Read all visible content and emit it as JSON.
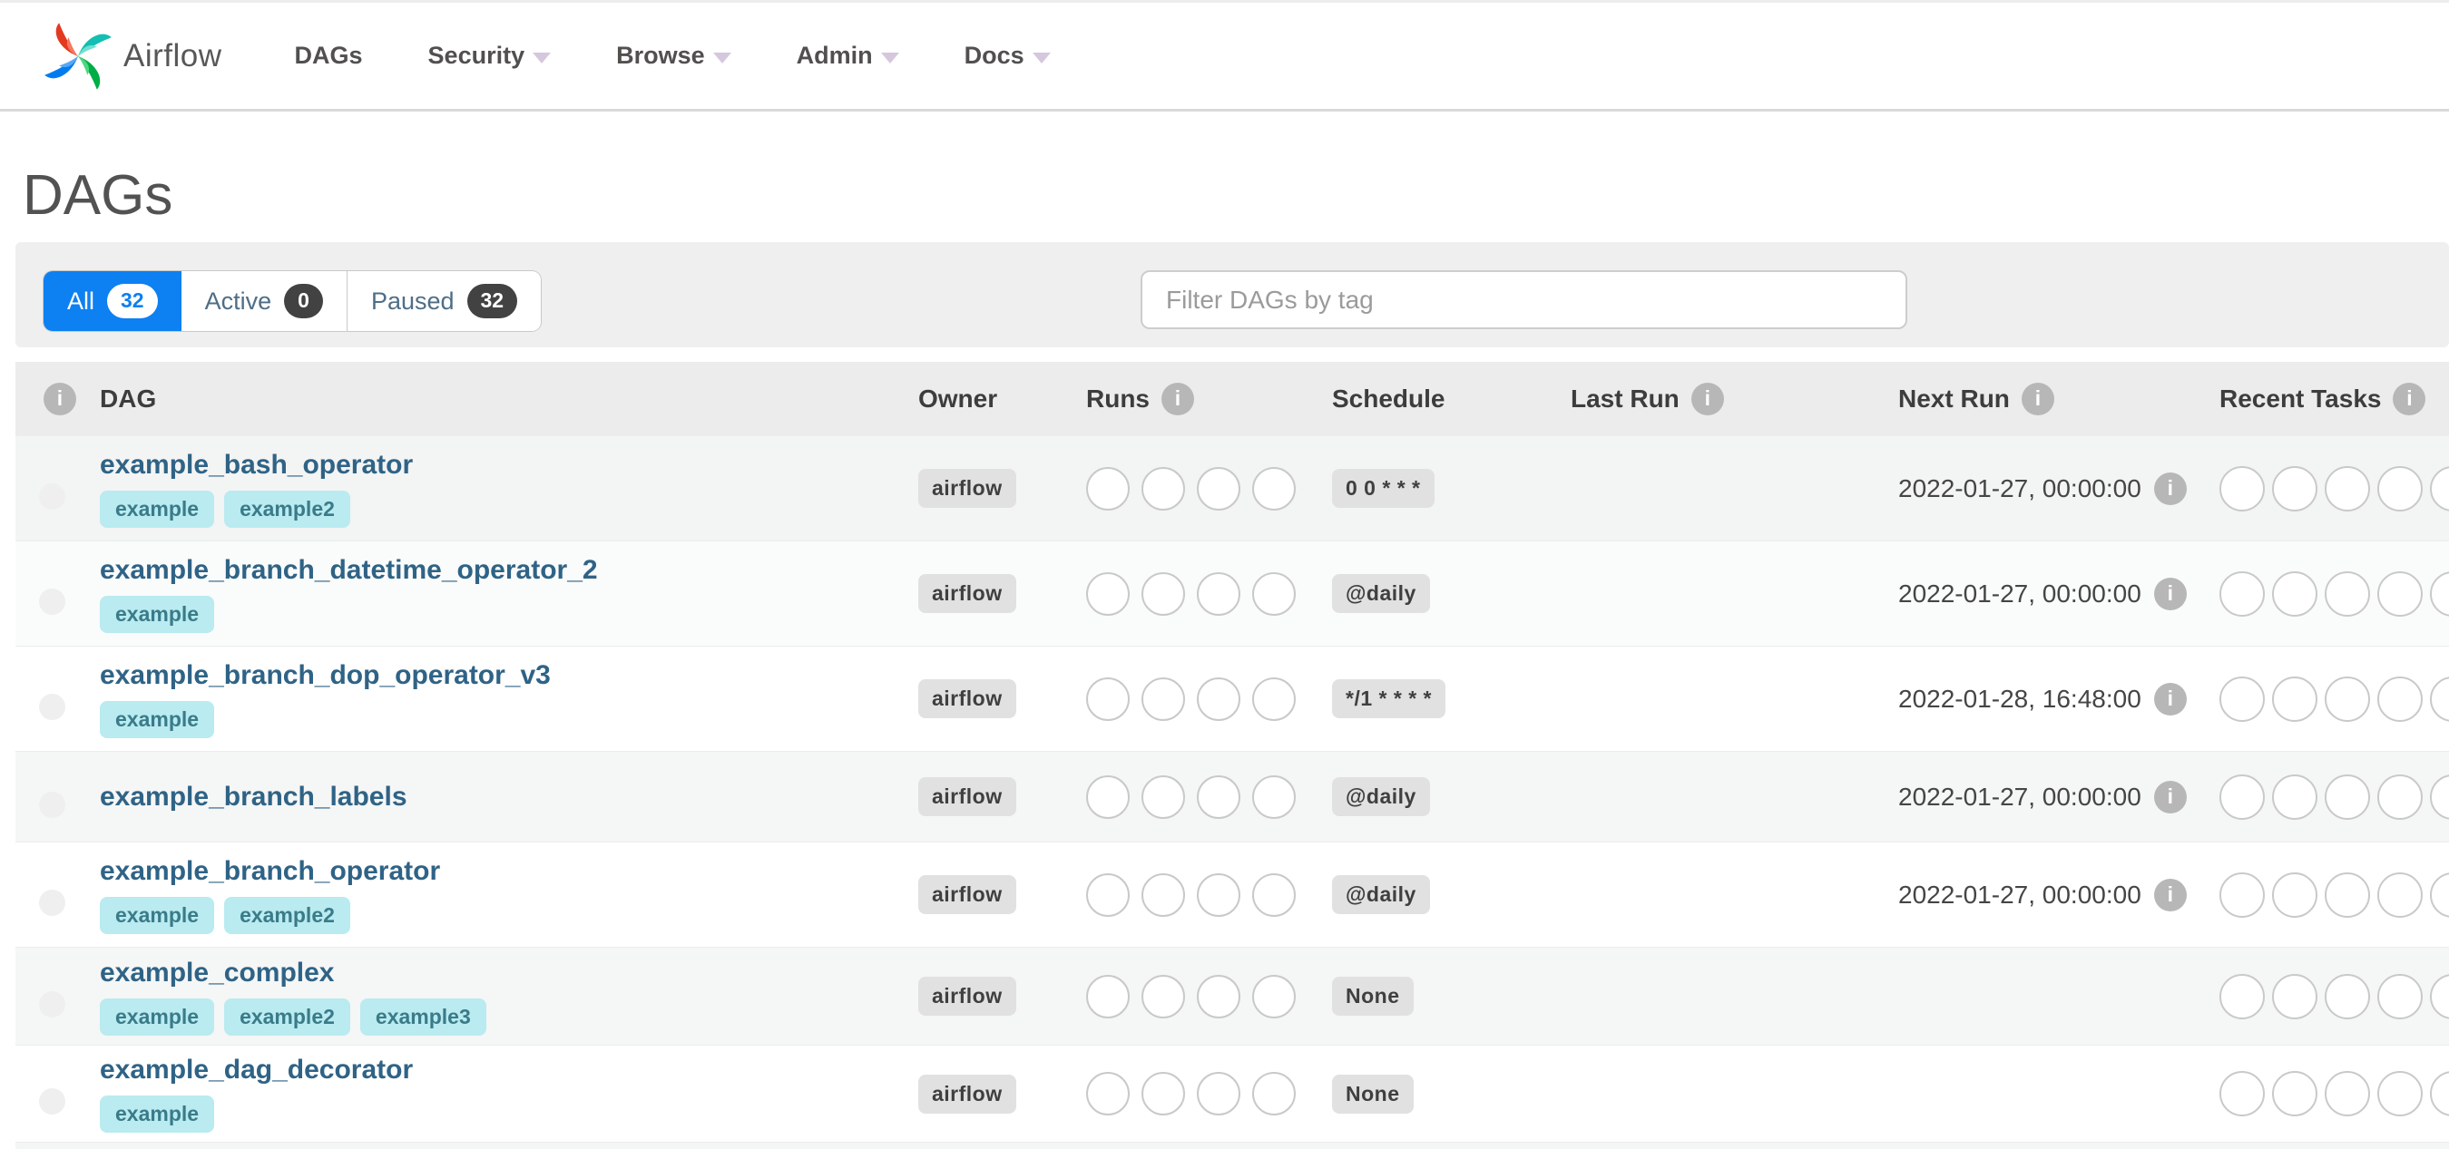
{
  "nav": {
    "brand": "Airflow",
    "items": [
      {
        "label": "DAGs",
        "caret": false
      },
      {
        "label": "Security",
        "caret": true
      },
      {
        "label": "Browse",
        "caret": true
      },
      {
        "label": "Admin",
        "caret": true
      },
      {
        "label": "Docs",
        "caret": true
      }
    ]
  },
  "page": {
    "title": "DAGs"
  },
  "filters": {
    "tabs": [
      {
        "label": "All",
        "count": "32",
        "active": true
      },
      {
        "label": "Active",
        "count": "0",
        "active": false
      },
      {
        "label": "Paused",
        "count": "32",
        "active": false
      }
    ],
    "search_placeholder": "Filter DAGs by tag"
  },
  "table": {
    "headers": {
      "dag": "DAG",
      "owner": "Owner",
      "runs": "Runs",
      "schedule": "Schedule",
      "last_run": "Last Run",
      "next_run": "Next Run",
      "recent_tasks": "Recent Tasks"
    },
    "info_glyph": "i",
    "runs_circle_count": 4,
    "recent_circle_count": 5,
    "rows": [
      {
        "name": "example_bash_operator",
        "tags": [
          "example",
          "example2"
        ],
        "owner": "airflow",
        "schedule": "0 0 * * *",
        "last_run": "",
        "next_run": "2022-01-27, 00:00:00"
      },
      {
        "name": "example_branch_datetime_operator_2",
        "tags": [
          "example"
        ],
        "owner": "airflow",
        "schedule": "@daily",
        "last_run": "",
        "next_run": "2022-01-27, 00:00:00"
      },
      {
        "name": "example_branch_dop_operator_v3",
        "tags": [
          "example"
        ],
        "owner": "airflow",
        "schedule": "*/1 * * * *",
        "last_run": "",
        "next_run": "2022-01-28, 16:48:00"
      },
      {
        "name": "example_branch_labels",
        "tags": [],
        "owner": "airflow",
        "schedule": "@daily",
        "last_run": "",
        "next_run": "2022-01-27, 00:00:00"
      },
      {
        "name": "example_branch_operator",
        "tags": [
          "example",
          "example2"
        ],
        "owner": "airflow",
        "schedule": "@daily",
        "last_run": "",
        "next_run": "2022-01-27, 00:00:00"
      },
      {
        "name": "example_complex",
        "tags": [
          "example",
          "example2",
          "example3"
        ],
        "owner": "airflow",
        "schedule": "None",
        "last_run": "",
        "next_run": ""
      },
      {
        "name": "example_dag_decorator",
        "tags": [
          "example"
        ],
        "owner": "airflow",
        "schedule": "None",
        "last_run": "",
        "next_run": ""
      }
    ]
  },
  "colors": {
    "accent_blue": "#0d80f2",
    "dag_link": "#2f6386",
    "tag_bg": "#b9ebf0",
    "tag_text": "#3a7b89",
    "badge_bg": "#e1e1e1",
    "logo_red": "#e43921",
    "logo_teal": "#12bfb2",
    "logo_green": "#00ad46",
    "logo_blue": "#017cee",
    "row_shades": [
      "#f3f4f4",
      "#fafbfb",
      "#ffffff",
      "#f5f6f6",
      "#ffffff",
      "#f5f6f6",
      "#ffffff"
    ]
  }
}
